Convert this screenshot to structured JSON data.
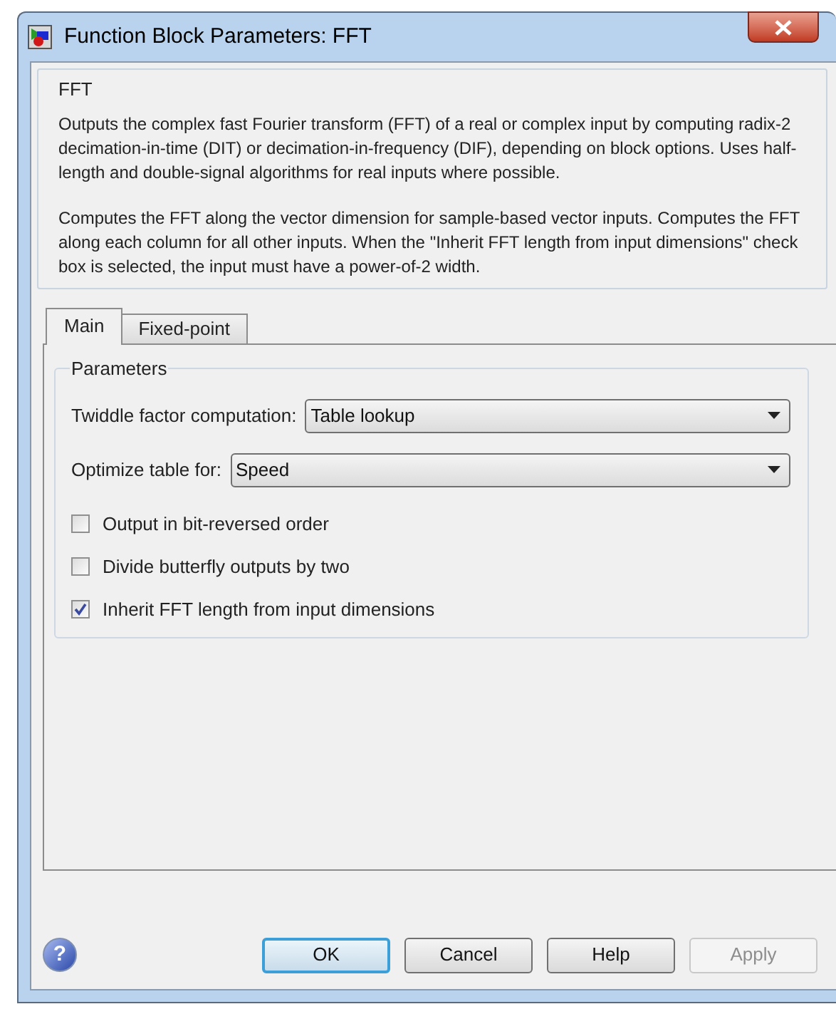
{
  "window": {
    "title": "Function Block Parameters: FFT"
  },
  "description": {
    "title": "FFT",
    "paragraphs": [
      "Outputs the complex fast Fourier transform (FFT) of a real or complex input by computing radix-2 decimation-in-time (DIT) or decimation-in-frequency (DIF), depending on block options. Uses half-length and double-signal algorithms for real inputs where possible.",
      "Computes the FFT along the vector dimension for sample-based vector inputs. Computes the FFT along each column for all other inputs. When the \"Inherit FFT length from input dimensions\" check box is selected, the input must have a power-of-2 width."
    ]
  },
  "tabs": [
    {
      "label": "Main",
      "selected": true
    },
    {
      "label": "Fixed-point",
      "selected": false
    }
  ],
  "parameters": {
    "title": "Parameters",
    "items": [
      {
        "kind": "dropdown",
        "label": "Twiddle factor computation:",
        "value": "Table lookup"
      },
      {
        "kind": "dropdown",
        "label": "Optimize table for:",
        "value": "Speed"
      },
      {
        "kind": "checkbox",
        "label": "Output in bit-reversed order",
        "checked": false
      },
      {
        "kind": "checkbox",
        "label": "Divide butterfly outputs by two",
        "checked": false
      },
      {
        "kind": "checkbox",
        "label": "Inherit FFT length from input dimensions",
        "checked": true
      }
    ]
  },
  "help_icon": "?",
  "buttons": [
    {
      "label": "OK",
      "disabled": false,
      "default": true
    },
    {
      "label": "Cancel",
      "disabled": false,
      "default": false
    },
    {
      "label": "Help",
      "disabled": false,
      "default": false
    },
    {
      "label": "Apply",
      "disabled": true,
      "default": false
    }
  ]
}
